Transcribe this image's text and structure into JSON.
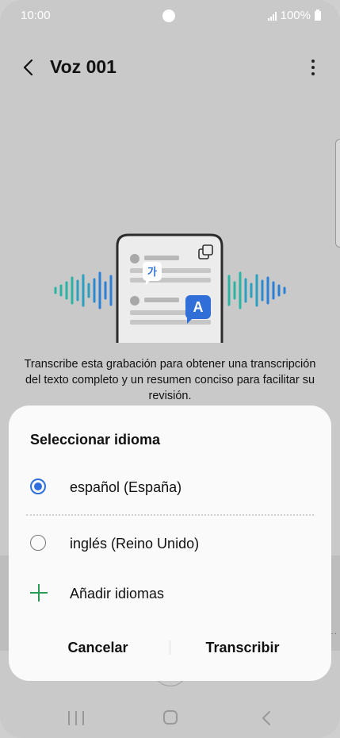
{
  "status": {
    "time": "10:00",
    "battery": "100%"
  },
  "header": {
    "title": "Voz 001"
  },
  "description": "Transcribe esta grabación para obtener una transcripción del texto completo y un resumen conciso para facilitar su revisión.",
  "illustration": {
    "korean_badge": "가",
    "a_badge": "A"
  },
  "dialog": {
    "title": "Seleccionar idioma",
    "options": [
      {
        "label": "español (España)",
        "selected": true
      },
      {
        "label": "inglés (Reino Unido)",
        "selected": false
      }
    ],
    "add_label": "Añadir idiomas",
    "cancel_label": "Cancelar",
    "confirm_label": "Transcribir"
  },
  "colors": {
    "accent": "#2e6fdd",
    "add": "#2a9a55",
    "dim_background": "#c9c9c9"
  }
}
